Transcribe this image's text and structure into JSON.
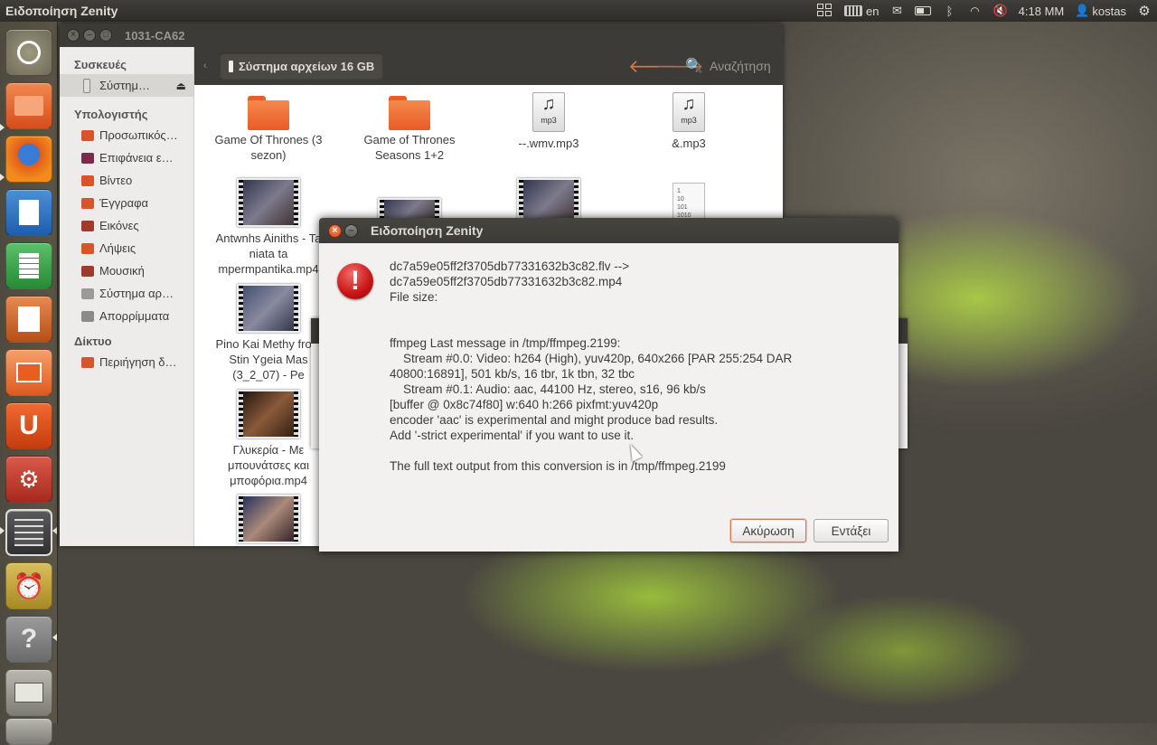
{
  "top_panel": {
    "app_title": "Ειδοποίηση Zenity",
    "keyboard_layout": "en",
    "clock": "4:18 ΜΜ",
    "user": "kostas"
  },
  "launcher": {
    "items": [
      {
        "name": "dash-home",
        "color": "#8a8575"
      },
      {
        "name": "files",
        "color": "#e35d2a"
      },
      {
        "name": "firefox",
        "color": "#d9511e"
      },
      {
        "name": "writer",
        "color": "#1d6fc2"
      },
      {
        "name": "calc",
        "color": "#2e9e3f"
      },
      {
        "name": "impress",
        "color": "#c25a1f"
      },
      {
        "name": "software-center",
        "color": "#e86a2b"
      },
      {
        "name": "ubuntu-one",
        "color": "#dd4814"
      },
      {
        "name": "system-settings",
        "color": "#c9352a"
      },
      {
        "name": "workspace-switcher",
        "color": "#4a4a4a"
      },
      {
        "name": "alarm-clock",
        "color": "#c9a43a"
      },
      {
        "name": "help",
        "color": "#7a7a7a"
      },
      {
        "name": "removable-drive",
        "color": "#9b9a93"
      }
    ]
  },
  "file_manager": {
    "window_title": "1031-CA62",
    "path_label": "Σύστημα αρχείων 16 GB",
    "search_label": "Αναζήτηση",
    "sidebar": {
      "devices_header": "Συσκευές",
      "devices": [
        "Σύστημ…"
      ],
      "computer_header": "Υπολογιστής",
      "computer": [
        {
          "label": "Προσωπικός…",
          "color": "#d9542a"
        },
        {
          "label": "Επιφάνεια ε…",
          "color": "#7a2a4a"
        },
        {
          "label": "Βίντεο",
          "color": "#d9542a"
        },
        {
          "label": "Έγγραφα",
          "color": "#d9542a"
        },
        {
          "label": "Εικόνες",
          "color": "#a03a2a"
        },
        {
          "label": "Λήψεις",
          "color": "#d9542a"
        },
        {
          "label": "Μουσική",
          "color": "#a03a2a"
        },
        {
          "label": "Σύστημα αρ…",
          "color": "#9a9a9a"
        },
        {
          "label": "Απορρίμματα",
          "color": "#8a8a8a"
        }
      ],
      "network_header": "Δίκτυο",
      "network": [
        {
          "label": "Περιήγηση δ…",
          "color": "#d9542a"
        }
      ]
    },
    "files": [
      {
        "name": "Game Of Thrones (3 sezon)"
      },
      {
        "name": "Game of Thrones Seasons 1+2"
      },
      {
        "name": "--.wmv.mp3",
        "badge": "mp3"
      },
      {
        "name": "&.mp3",
        "badge": "mp3"
      },
      {
        "name": "Antwnhs Ainiths - Ta niata ta mpermpantika.mp4"
      },
      {
        "name": "Pino Kai Methy from Stin Ygeia Mas (3_2_07) - Pe"
      },
      {
        "name": "Γλυκερία - Με μπουνάτσες και μποφόρια.mp4"
      }
    ],
    "textfile_lines": [
      "1",
      "10",
      "101",
      "1010"
    ]
  },
  "dialog": {
    "title": "Ειδοποίηση Zenity",
    "message": "dc7a59e05ff2f3705db77331632b3c82.flv -->\ndc7a59e05ff2f3705db77331632b3c82.mp4\nFile size:\n\n\nffmpeg Last message in /tmp/ffmpeg.2199:\n    Stream #0.0: Video: h264 (High), yuv420p, 640x266 [PAR 255:254 DAR\n40800:16891], 501 kb/s, 16 tbr, 1k tbn, 32 tbc\n    Stream #0.1: Audio: aac, 44100 Hz, stereo, s16, 96 kb/s\n[buffer @ 0x8c74f80] w:640 h:266 pixfmt:yuv420p\nencoder 'aac' is experimental and might produce bad results.\nAdd '-strict experimental' if you want to use it.\n\nThe full text output from this conversion is in /tmp/ffmpeg.2199",
    "cancel_label": "Ακύρωση",
    "ok_label": "Εντάξει"
  }
}
